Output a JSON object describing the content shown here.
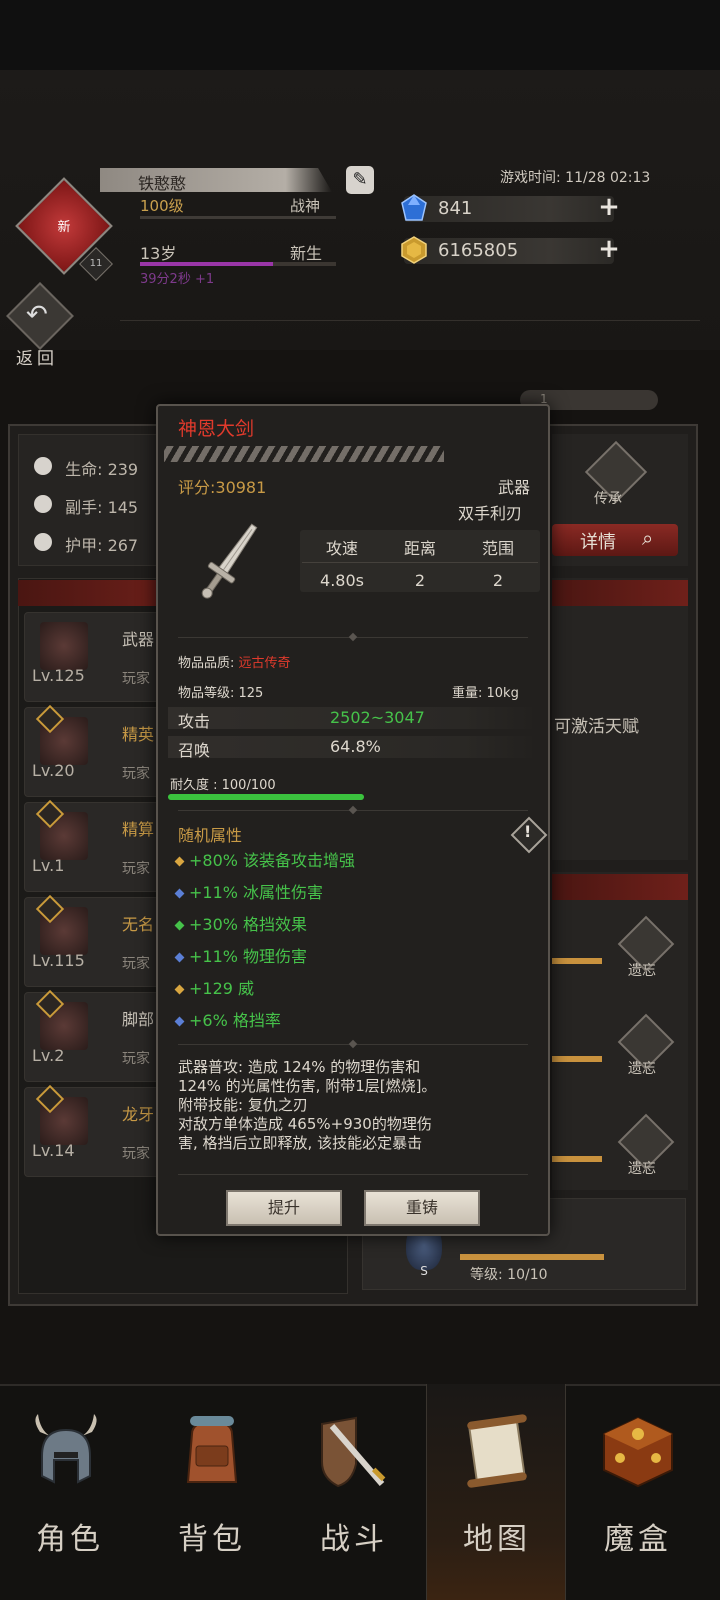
{
  "header": {
    "player_name": "铁憨憨",
    "emblem_text": "新",
    "emblem_level": "11",
    "level": "100级",
    "title": "战神",
    "age": "13岁",
    "age_title": "新生",
    "age_timer": "39分2秒 +1",
    "age_progress": 0.68,
    "game_time": "游戏时间: 11/28 02:13",
    "gems": "841",
    "gold": "6165805",
    "back_label": "返回",
    "slider_value": "1"
  },
  "stats": {
    "hp": "生命: 239",
    "offhand": "副手: 145",
    "armor": "护甲: 267"
  },
  "side": {
    "inherit_label": "传承",
    "detail_label": "详情",
    "talent_text": "可激活天赋",
    "forget_label": "遗忘",
    "slot_level": "等级: 10/10",
    "slot_badge": "S"
  },
  "equip_list": [
    {
      "lv": "Lv.125",
      "name": "武器",
      "sub": "玩家"
    },
    {
      "lv": "Lv.20",
      "name": "精英",
      "sub": "玩家"
    },
    {
      "lv": "Lv.1",
      "name": "精算",
      "sub": "玩家"
    },
    {
      "lv": "Lv.115",
      "name": "无名",
      "sub": "玩家"
    },
    {
      "lv": "Lv.2",
      "name": "脚部",
      "sub": "玩家"
    },
    {
      "lv": "Lv.14",
      "name": "龙牙",
      "sub": "玩家"
    }
  ],
  "item": {
    "name": "神恩大剑",
    "score": "评分:30981",
    "type": "武器",
    "subtype": "双手利刃",
    "stat_headers": [
      "攻速",
      "距离",
      "范围"
    ],
    "stat_values": [
      "4.80s",
      "2",
      "2"
    ],
    "quality_label": "物品品质:",
    "quality_value": "远古传奇",
    "item_level": "物品等级: 125",
    "weight": "重量: 10kg",
    "attack_label": "攻击",
    "attack_value": "2502~3047",
    "summon_label": "召唤",
    "summon_value": "64.8%",
    "durability": "耐久度 : 100/100",
    "durability_ratio": 1.0,
    "random_title": "随机属性",
    "random_attrs": [
      {
        "text": "+80% 该装备攻击增强",
        "dot_color": "#d9a640"
      },
      {
        "text": "+11% 冰属性伤害",
        "dot_color": "#5b7fd6"
      },
      {
        "text": "+30% 格挡效果",
        "dot_color": "#46c24a"
      },
      {
        "text": "+11% 物理伤害",
        "dot_color": "#5b7fd6"
      },
      {
        "text": "+129 威",
        "dot_color": "#d9a640"
      },
      {
        "text": "+6% 格挡率",
        "dot_color": "#5b7fd6"
      }
    ],
    "desc_lines": [
      "武器普攻: 造成 124% 的物理伤害和",
      "124% 的光属性伤害, 附带1层[燃烧]。",
      "附带技能: 复仇之刃",
      "对敌方单体造成 465%+930的物理伤",
      "害, 格挡后立即释放, 该技能必定暴击"
    ],
    "btn_upgrade": "提升",
    "btn_reforge": "重铸"
  },
  "nav": [
    {
      "label": "角色",
      "icon": "helmet-icon"
    },
    {
      "label": "背包",
      "icon": "backpack-icon"
    },
    {
      "label": "战斗",
      "icon": "sword-shield-icon"
    },
    {
      "label": "地图",
      "icon": "scroll-map-icon",
      "active": true
    },
    {
      "label": "魔盒",
      "icon": "magic-box-icon"
    }
  ],
  "colors": {
    "accent_red": "#e03a2c",
    "gold_text": "#c89a46",
    "green_text": "#46c24a"
  }
}
